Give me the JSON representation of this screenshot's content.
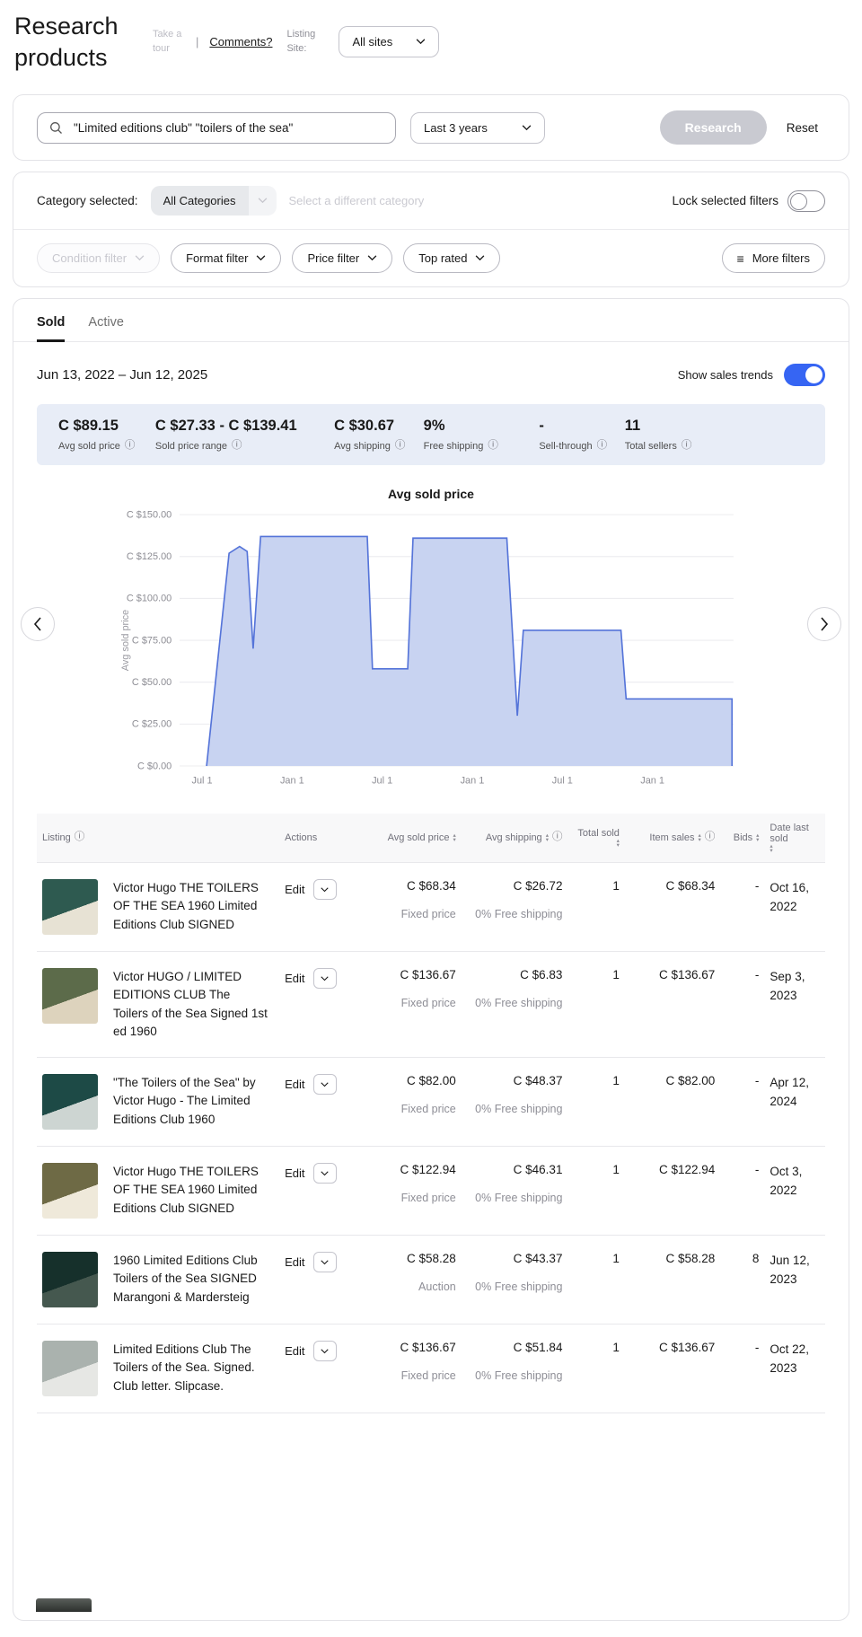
{
  "icons": {
    "info": "ⓘ",
    "sort_asc": "▴",
    "sort_desc": "▾",
    "hamburger": "≡"
  },
  "header": {
    "title": "Research products",
    "take_a_tour": "Take a tour",
    "pipe": "|",
    "comments": "Comments?",
    "listing_site_label": "Listing Site:",
    "listing_site_value": "All sites"
  },
  "search": {
    "query": "\"Limited editions club\" \"toilers of the sea\"",
    "date_range_value": "Last 3 years",
    "research_button": "Research",
    "reset_button": "Reset"
  },
  "filters": {
    "category_label": "Category selected:",
    "category_value": "All Categories",
    "select_different_label": "Select a different category",
    "lock_label": "Lock selected filters",
    "chips": [
      {
        "label": "Condition filter",
        "disabled": true
      },
      {
        "label": "Format filter",
        "disabled": false
      },
      {
        "label": "Price filter",
        "disabled": false
      },
      {
        "label": "Top rated",
        "disabled": false
      }
    ],
    "more_filters_label": "More filters"
  },
  "tabs": [
    {
      "label": "Sold",
      "active": true
    },
    {
      "label": "Active",
      "active": false
    }
  ],
  "results": {
    "date_range": "Jun 13, 2022 – Jun 12, 2025",
    "show_trends_label": "Show sales trends",
    "stats": [
      {
        "value": "C $89.15",
        "label": "Avg sold price"
      },
      {
        "value": "C $27.33 - C $139.41",
        "label": "Sold price range"
      },
      {
        "value": "C $30.67",
        "label": "Avg shipping"
      },
      {
        "value": "9%",
        "label": "Free shipping"
      },
      {
        "value": "-",
        "label": "Sell-through"
      },
      {
        "value": "11",
        "label": "Total sellers"
      }
    ]
  },
  "chart_data": {
    "type": "area",
    "title": "Avg sold price",
    "ylabel": "Avg sold price",
    "currency": "CAD",
    "ylim": [
      0,
      150
    ],
    "y_ticks": [
      "C $150.00",
      "C $125.00",
      "C $100.00",
      "C $75.00",
      "C $50.00",
      "C $25.00",
      "C $0.00"
    ],
    "x_unit": "months since Jul 1, 2022",
    "x_domain": [
      -1.5,
      35.4
    ],
    "x_ticks": [
      {
        "pos": 0,
        "label": "Jul 1"
      },
      {
        "pos": 6,
        "label": "Jan 1"
      },
      {
        "pos": 12,
        "label": "Jul 1"
      },
      {
        "pos": 18,
        "label": "Jan 1"
      },
      {
        "pos": 24,
        "label": "Jul 1"
      },
      {
        "pos": 30,
        "label": "Jan 1"
      }
    ],
    "points": [
      [
        0.3,
        0
      ],
      [
        1.8,
        127
      ],
      [
        2.5,
        131
      ],
      [
        3.0,
        128
      ],
      [
        3.4,
        70
      ],
      [
        3.9,
        137
      ],
      [
        11.0,
        137
      ],
      [
        11.35,
        58
      ],
      [
        13.7,
        58
      ],
      [
        14.05,
        136
      ],
      [
        20.3,
        136
      ],
      [
        21.0,
        30
      ],
      [
        21.4,
        81
      ],
      [
        27.9,
        81
      ],
      [
        28.25,
        40
      ],
      [
        35.3,
        40
      ],
      [
        35.3,
        0
      ]
    ],
    "fill_color": "#c8d3f1",
    "line_color": "#5574d9",
    "grid_color": "#ececef",
    "legend_position": "none",
    "grid": true
  },
  "table": {
    "headers": [
      {
        "label": "Listing",
        "info": true
      },
      {
        "label": "Actions"
      },
      {
        "label": "Avg sold price",
        "sortable": true
      },
      {
        "label": "Avg shipping",
        "sortable": true,
        "info": true
      },
      {
        "label": "Total sold",
        "sortable": true
      },
      {
        "label": "Item sales",
        "sortable": true,
        "info": true
      },
      {
        "label": "Bids",
        "sortable": true
      },
      {
        "label": "Date last sold",
        "sortable": true
      }
    ],
    "rows": [
      {
        "title": "Victor Hugo THE TOILERS OF THE SEA 1960 Limited Editions Club SIGNED",
        "action": "Edit",
        "avg_sold_price": "C $68.34",
        "format": "Fixed price",
        "avg_shipping": "C $26.72",
        "shipping_note": "0% Free shipping",
        "total_sold": "1",
        "item_sales": "C $68.34",
        "bids": "-",
        "date_last_sold": "Oct 16, 2022",
        "thumb_colors": [
          "#2e5a50",
          "#e7e2d4"
        ]
      },
      {
        "title": "Victor HUGO / LIMITED EDITIONS CLUB The Toilers of the Sea Signed 1st ed 1960",
        "action": "Edit",
        "avg_sold_price": "C $136.67",
        "format": "Fixed price",
        "avg_shipping": "C $6.83",
        "shipping_note": "0% Free shipping",
        "total_sold": "1",
        "item_sales": "C $136.67",
        "bids": "-",
        "date_last_sold": "Sep 3, 2023",
        "thumb_colors": [
          "#5c6b4a",
          "#ddd3bd"
        ]
      },
      {
        "title": "\"The Toilers of the Sea\" by Victor Hugo - The Limited Editions Club 1960",
        "action": "Edit",
        "avg_sold_price": "C $82.00",
        "format": "Fixed price",
        "avg_shipping": "C $48.37",
        "shipping_note": "0% Free shipping",
        "total_sold": "1",
        "item_sales": "C $82.00",
        "bids": "-",
        "date_last_sold": "Apr 12, 2024",
        "thumb_colors": [
          "#1d4a46",
          "#cdd5d2"
        ]
      },
      {
        "title": "Victor Hugo THE TOILERS OF THE SEA 1960 Limited Editions Club SIGNED",
        "action": "Edit",
        "avg_sold_price": "C $122.94",
        "format": "Fixed price",
        "avg_shipping": "C $46.31",
        "shipping_note": "0% Free shipping",
        "total_sold": "1",
        "item_sales": "C $122.94",
        "bids": "-",
        "date_last_sold": "Oct 3, 2022",
        "thumb_colors": [
          "#6e6a45",
          "#efe9da"
        ]
      },
      {
        "title": "1960 Limited Editions Club Toilers of the Sea SIGNED Marangoni & Mardersteig",
        "action": "Edit",
        "avg_sold_price": "C $58.28",
        "format": "Auction",
        "avg_shipping": "C $43.37",
        "shipping_note": "0% Free shipping",
        "total_sold": "1",
        "item_sales": "C $58.28",
        "bids": "8",
        "date_last_sold": "Jun 12, 2023",
        "thumb_colors": [
          "#16302b",
          "#45584f"
        ]
      },
      {
        "title": "Limited Editions Club The Toilers of the Sea. Signed. Club letter. Slipcase.",
        "action": "Edit",
        "avg_sold_price": "C $136.67",
        "format": "Fixed price",
        "avg_shipping": "C $51.84",
        "shipping_note": "0% Free shipping",
        "total_sold": "1",
        "item_sales": "C $136.67",
        "bids": "-",
        "date_last_sold": "Oct 22, 2023",
        "thumb_colors": [
          "#aab2ae",
          "#e6e7e4"
        ]
      }
    ]
  }
}
